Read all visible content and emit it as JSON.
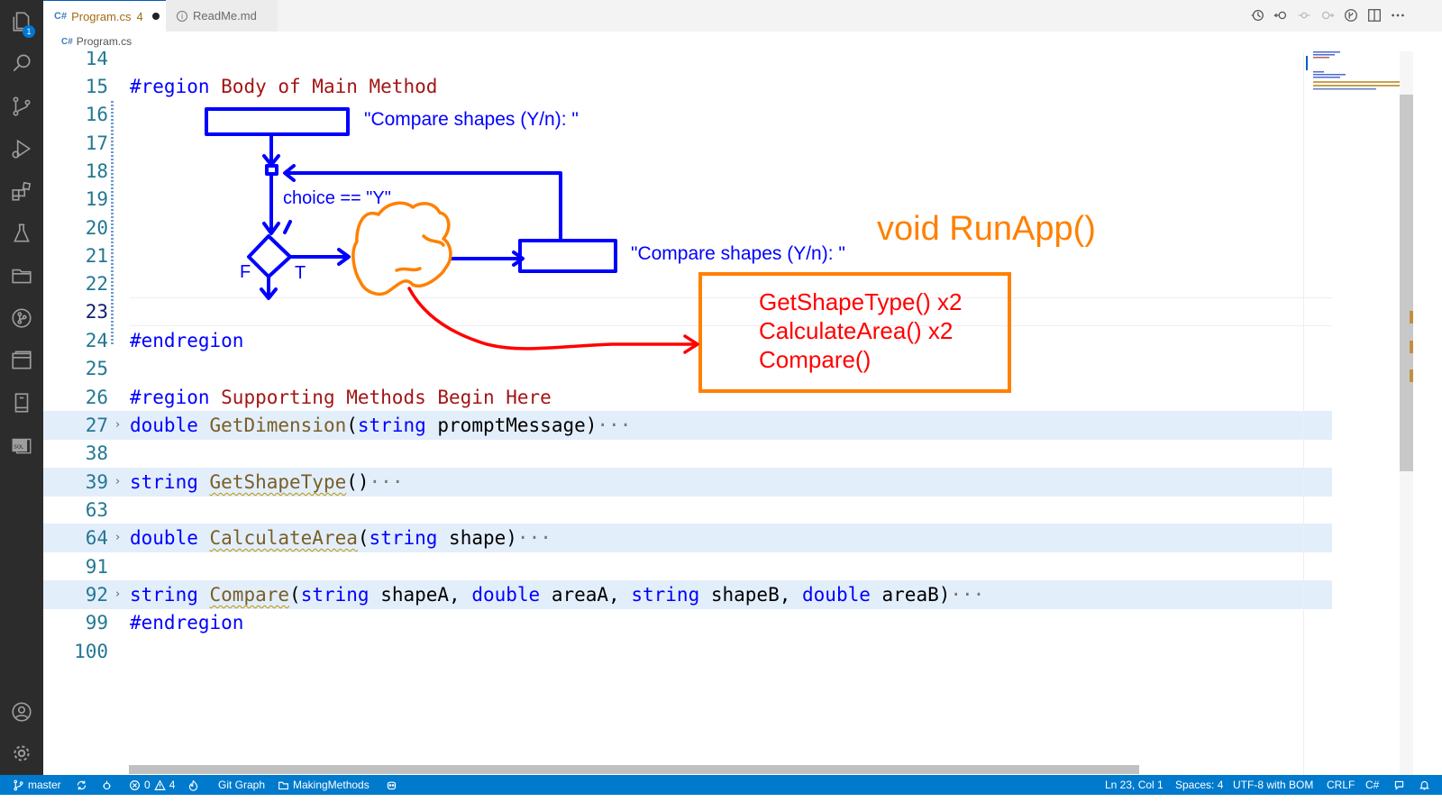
{
  "tabs": [
    {
      "icon_text": "C#",
      "label": "Program.cs",
      "problems": "4",
      "modified": true
    },
    {
      "icon_text": "i",
      "label": "ReadMe.md"
    }
  ],
  "breadcrumb": {
    "icon_text": "C#",
    "label": "Program.cs"
  },
  "activity_bar": {
    "explorer_badge": "1",
    "icons": [
      "files-icon",
      "search-icon",
      "source-control-icon",
      "run-debug-icon",
      "extensions-icon",
      "testing-icon",
      "folder-icon",
      "git-graph-icon",
      "panel-icon",
      "book-icon",
      "sql-icon",
      "account-icon",
      "settings-gear-icon"
    ]
  },
  "editor": {
    "lines": [
      {
        "n": "14"
      },
      {
        "n": "15",
        "t1": "#region",
        "t2": " Body of Main Method"
      },
      {
        "n": "16"
      },
      {
        "n": "17"
      },
      {
        "n": "18"
      },
      {
        "n": "19"
      },
      {
        "n": "20"
      },
      {
        "n": "21"
      },
      {
        "n": "22"
      },
      {
        "n": "23"
      },
      {
        "n": "24",
        "t1": "#endregion"
      },
      {
        "n": "25"
      },
      {
        "n": "26",
        "t1": "#region",
        "t2": " Supporting Methods Begin Here"
      },
      {
        "n": "27",
        "kw": "double",
        "fn": "GetDimension",
        "rest_a": "(",
        "kw2": "string",
        "rest_b": " promptMessage)",
        "dots": "···"
      },
      {
        "n": "38"
      },
      {
        "n": "39",
        "kw": "string",
        "fn": "GetShapeType",
        "rest_a": "()",
        "dots": "···"
      },
      {
        "n": "63"
      },
      {
        "n": "64",
        "kw": "double",
        "fn": "CalculateArea",
        "rest_a": "(",
        "kw2": "string",
        "rest_b": " shape)",
        "dots": "···"
      },
      {
        "n": "91"
      },
      {
        "n": "92",
        "kw": "string",
        "fn": "Compare",
        "p1": "(",
        "k1": "string",
        "p2": " shapeA, ",
        "k2": "double",
        "p3": " areaA, ",
        "k3": "string",
        "p4": " shapeB, ",
        "k4": "double",
        "p5": " areaB)",
        "dots": "···"
      },
      {
        "n": "99",
        "t1": "#endregion"
      },
      {
        "n": "100"
      }
    ]
  },
  "annotations": {
    "prompt_top": "\"Compare shapes (Y/n): \"",
    "condition": "choice == \"Y\"",
    "false_label": "F",
    "true_label": "T",
    "prompt_right": "\"Compare shapes (Y/n): \"",
    "method_title": "void RunApp()",
    "calls": [
      "GetShapeType() x2",
      "CalculateArea() x2",
      "Compare()"
    ],
    "colors": {
      "flow": "#0000ff",
      "cloud": "#ff8000",
      "arrow": "#ff0000",
      "calls_text": "#ff0000",
      "title": "#ff8000"
    }
  },
  "status_bar": {
    "branch": "master",
    "errors": "0",
    "warnings": "4",
    "git_graph": "Git Graph",
    "folder": "MakingMethods",
    "cursor": "Ln 23, Col 1",
    "spaces": "Spaces: 4",
    "encoding": "UTF-8 with BOM",
    "eol": "CRLF",
    "language": "C#"
  }
}
